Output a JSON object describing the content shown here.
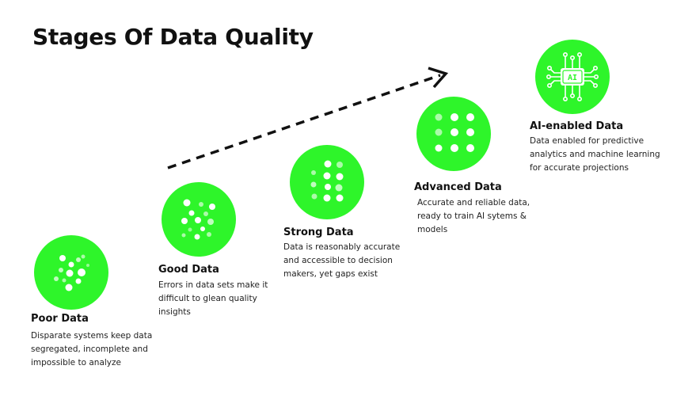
{
  "title": "Stages Of Data Quality",
  "colors": {
    "accent": "#2ef52a",
    "text": "#111111",
    "arrow": "#111111"
  },
  "stages": [
    {
      "name": "Poor Data",
      "description": "Disparate systems keep data segregated, incomplete and impossible to analyze"
    },
    {
      "name": "Good Data",
      "description": "Errors in data sets make it difficult to glean quality insights"
    },
    {
      "name": "Strong Data",
      "description": "Data is reasonably accurate and accessible to decision makers, yet gaps exist"
    },
    {
      "name": "Advanced Data",
      "description": "Accurate and reliable data, ready to train AI sytems & models"
    },
    {
      "name": "AI-enabled Data",
      "description": "Data enabled for predictive analytics and machine learning for accurate projections"
    }
  ],
  "ai_chip_label": "AI",
  "progression_arrow": {
    "icon": "dashed-arrow-up-right"
  }
}
